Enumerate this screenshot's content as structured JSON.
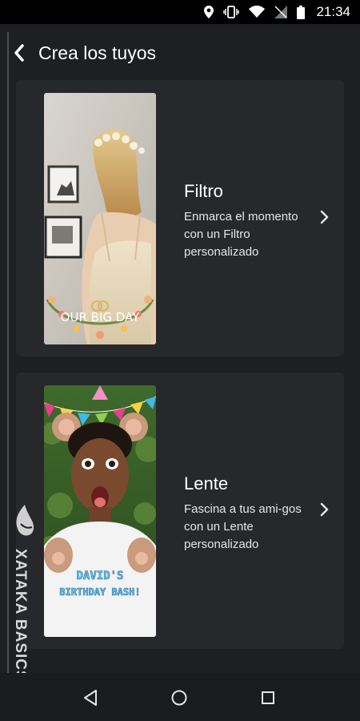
{
  "status_bar": {
    "time": "21:34",
    "icons": [
      "location-icon",
      "vibrate-icon",
      "wifi-icon",
      "no-signal-icon",
      "battery-icon"
    ]
  },
  "header": {
    "title": "Crea los tuyos",
    "back_icon": "chevron-left-icon"
  },
  "cards": [
    {
      "title": "Filtro",
      "description": "Enmarca el momento con un Filtro personalizado",
      "thumbnail_caption": "OUR BIG DAY",
      "icon": "chevron-right-icon"
    },
    {
      "title": "Lente",
      "description": "Fascina a tus ami-gos con un Lente personalizado",
      "thumbnail_caption_line1": "DAVID'S",
      "thumbnail_caption_line2": "BIRTHDAY BASH!",
      "icon": "chevron-right-icon"
    }
  ],
  "watermark": {
    "text": "XATAKA BASICS"
  },
  "nav_bar": {
    "buttons": [
      "back-triangle-icon",
      "home-circle-icon",
      "recents-square-icon"
    ]
  },
  "colors": {
    "background": "#1d1f22",
    "card": "#26282c",
    "text": "#ffffff"
  }
}
